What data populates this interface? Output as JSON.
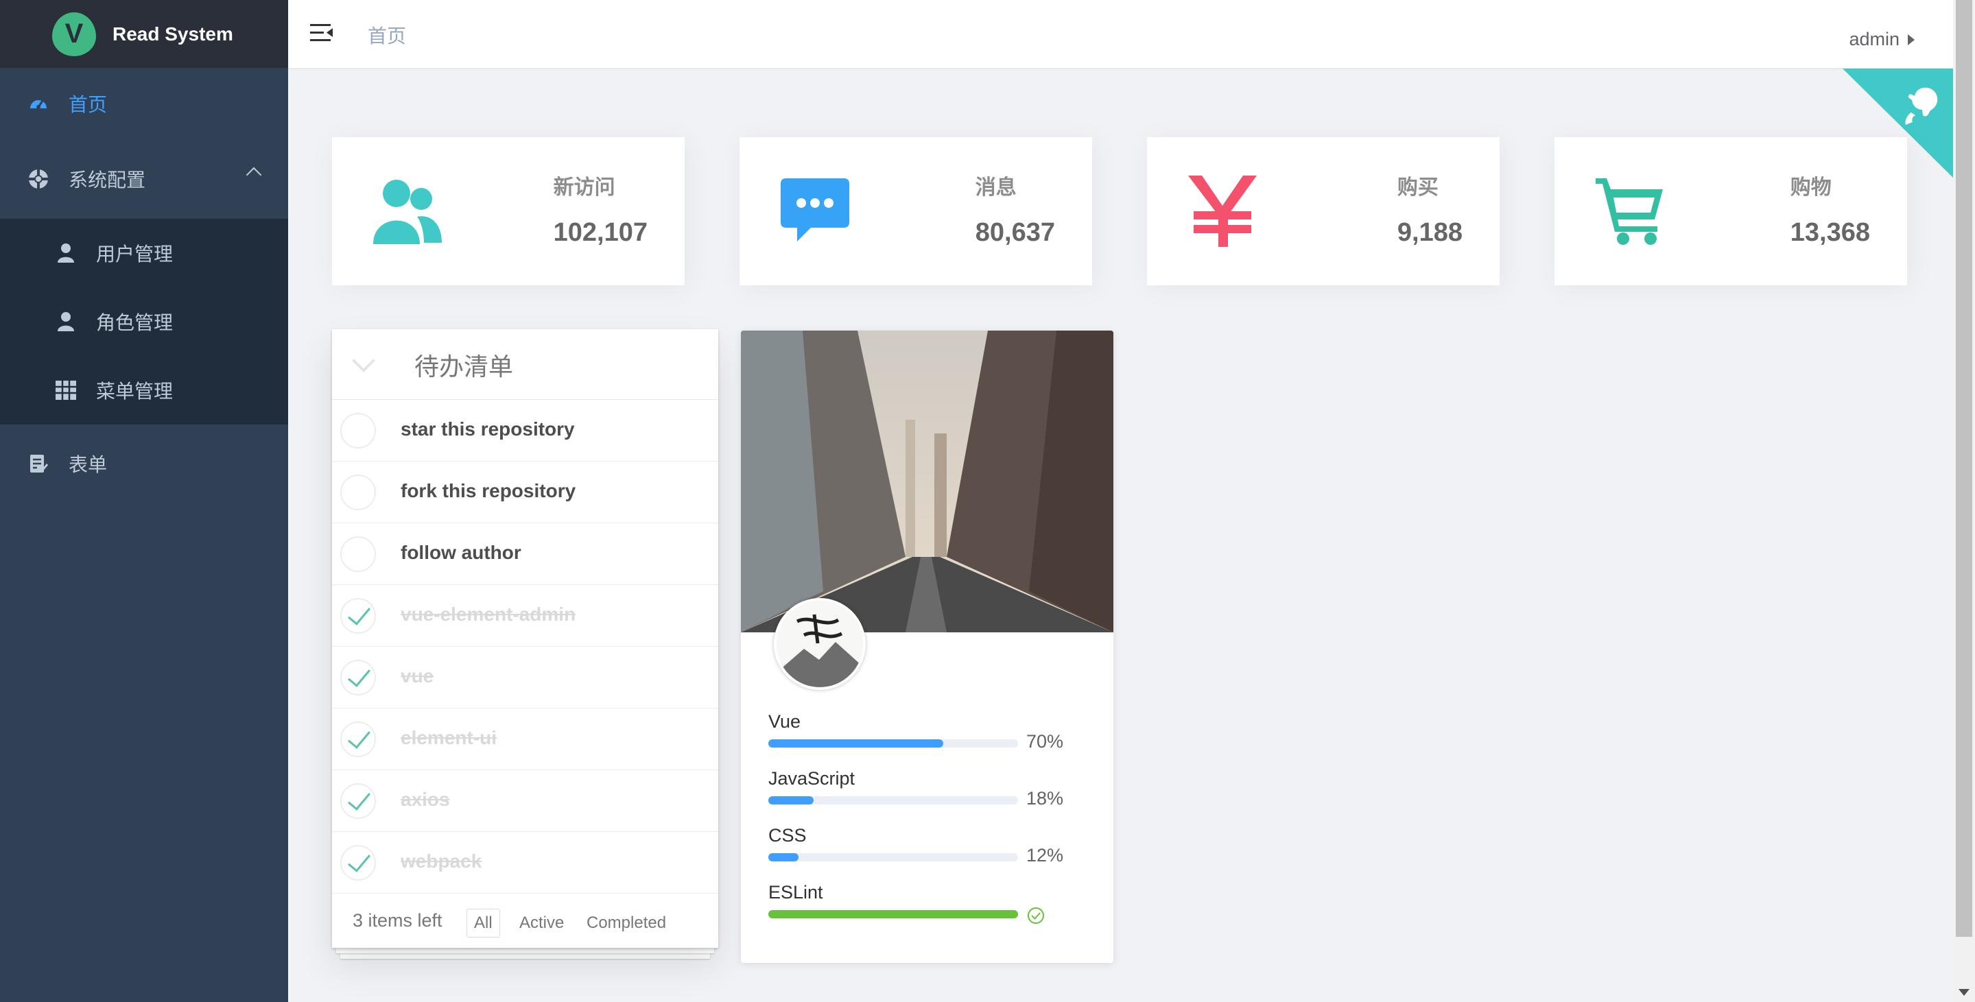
{
  "app": {
    "title": "Read System"
  },
  "sidebar": {
    "items": [
      {
        "label": "首页",
        "icon": "dashboard-icon",
        "active": true
      },
      {
        "label": "系统配置",
        "icon": "settings-icon",
        "expanded": true,
        "children": [
          {
            "label": "用户管理",
            "icon": "user-icon"
          },
          {
            "label": "角色管理",
            "icon": "user-icon"
          },
          {
            "label": "菜单管理",
            "icon": "table-icon"
          }
        ]
      },
      {
        "label": "表单",
        "icon": "form-icon"
      }
    ]
  },
  "navbar": {
    "breadcrumb": "首页",
    "user": "admin"
  },
  "panels": [
    {
      "label": "新访问",
      "value": "102,107",
      "icon": "peoples-icon",
      "color": "#40c9c6"
    },
    {
      "label": "消息",
      "value": "80,637",
      "icon": "message-icon",
      "color": "#36a3f7"
    },
    {
      "label": "购买",
      "value": "9,188",
      "icon": "money-icon",
      "color": "#f4516c"
    },
    {
      "label": "购物",
      "value": "13,368",
      "icon": "shopping-icon",
      "color": "#34bfa3"
    }
  ],
  "todo": {
    "title": "待办清单",
    "items": [
      {
        "text": "star this repository",
        "done": false
      },
      {
        "text": "fork this repository",
        "done": false
      },
      {
        "text": "follow author",
        "done": false
      },
      {
        "text": "vue-element-admin",
        "done": true
      },
      {
        "text": "vue",
        "done": true
      },
      {
        "text": "element-ui",
        "done": true
      },
      {
        "text": "axios",
        "done": true
      },
      {
        "text": "webpack",
        "done": true
      }
    ],
    "count_text": "3 items left",
    "filters": [
      "All",
      "Active",
      "Completed"
    ],
    "selected_filter": "All"
  },
  "box_card": {
    "progress": [
      {
        "label": "Vue",
        "percent": 70,
        "percent_text": "70%"
      },
      {
        "label": "JavaScript",
        "percent": 18,
        "percent_text": "18%"
      },
      {
        "label": "CSS",
        "percent": 12,
        "percent_text": "12%"
      },
      {
        "label": "ESLint",
        "percent": 100,
        "status": "success"
      }
    ]
  },
  "colors": {
    "accent": "#409eff",
    "success": "#67c23a",
    "sidebar": "#304156"
  }
}
